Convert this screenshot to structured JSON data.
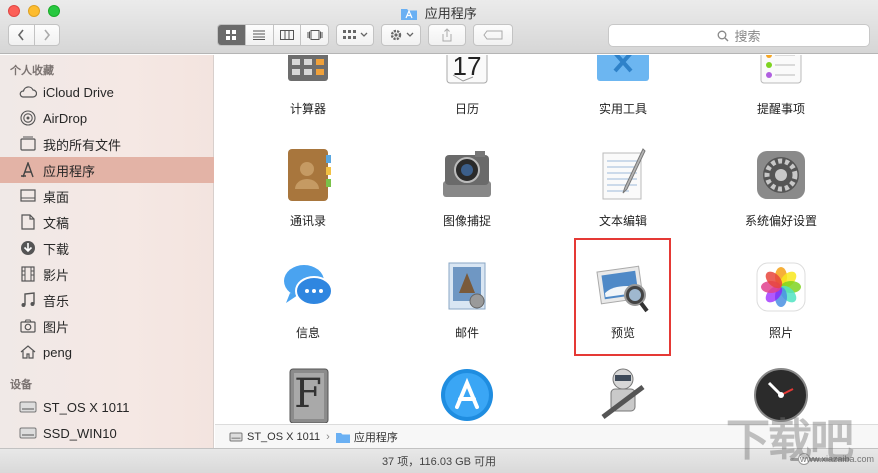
{
  "window": {
    "title": "应用程序"
  },
  "toolbar": {
    "back_icon": "chevron-left",
    "forward_icon": "chevron-right",
    "view_modes": [
      "icon-view",
      "list-view",
      "column-view",
      "cover-flow-view"
    ],
    "arrange_icon": "grid-arrange",
    "action_icon": "gear",
    "share_icon": "share",
    "tag_icon": "tag"
  },
  "search": {
    "placeholder": "搜索"
  },
  "sidebar": {
    "favorites_header": "个人收藏",
    "favorites": [
      {
        "label": "iCloud Drive",
        "icon": "cloud-icon"
      },
      {
        "label": "AirDrop",
        "icon": "airdrop-icon"
      },
      {
        "label": "我的所有文件",
        "icon": "all-files-icon"
      },
      {
        "label": "应用程序",
        "icon": "applications-icon",
        "selected": true
      },
      {
        "label": "桌面",
        "icon": "desktop-icon"
      },
      {
        "label": "文稿",
        "icon": "documents-icon"
      },
      {
        "label": "下载",
        "icon": "downloads-icon"
      },
      {
        "label": "影片",
        "icon": "movies-icon"
      },
      {
        "label": "音乐",
        "icon": "music-icon"
      },
      {
        "label": "图片",
        "icon": "pictures-icon"
      },
      {
        "label": "peng",
        "icon": "home-icon"
      }
    ],
    "devices_header": "设备",
    "devices": [
      {
        "label": "ST_OS X 1011",
        "icon": "disk-icon"
      },
      {
        "label": "SSD_WIN10",
        "icon": "disk-icon"
      }
    ]
  },
  "apps": [
    {
      "label": "计算器",
      "icon": "calculator-icon"
    },
    {
      "label": "日历",
      "icon": "calendar-icon",
      "day": "17"
    },
    {
      "label": "实用工具",
      "icon": "utilities-folder-icon"
    },
    {
      "label": "提醒事项",
      "icon": "reminders-icon"
    },
    {
      "label": "通讯录",
      "icon": "contacts-icon"
    },
    {
      "label": "图像捕捉",
      "icon": "image-capture-icon"
    },
    {
      "label": "文本编辑",
      "icon": "textedit-icon"
    },
    {
      "label": "系统偏好设置",
      "icon": "system-preferences-icon"
    },
    {
      "label": "信息",
      "icon": "messages-icon"
    },
    {
      "label": "邮件",
      "icon": "mail-icon"
    },
    {
      "label": "预览",
      "icon": "preview-icon",
      "highlighted": true
    },
    {
      "label": "照片",
      "icon": "photos-icon"
    },
    {
      "label": "",
      "icon": "font-book-icon",
      "glyph": "F"
    },
    {
      "label": "",
      "icon": "app-store-icon"
    },
    {
      "label": "",
      "icon": "automator-icon"
    },
    {
      "label": "",
      "icon": "dashboard-icon"
    }
  ],
  "pathbar": {
    "disk": "ST_OS X 1011",
    "separator": "›",
    "folder": "应用程序"
  },
  "status": {
    "text": "37 项，116.03 GB 可用"
  },
  "watermark": {
    "text": "下载吧",
    "url": "www.xiazaiba.com"
  },
  "colors": {
    "selection": "#e3b3a6",
    "highlight_box": "#e53935"
  }
}
